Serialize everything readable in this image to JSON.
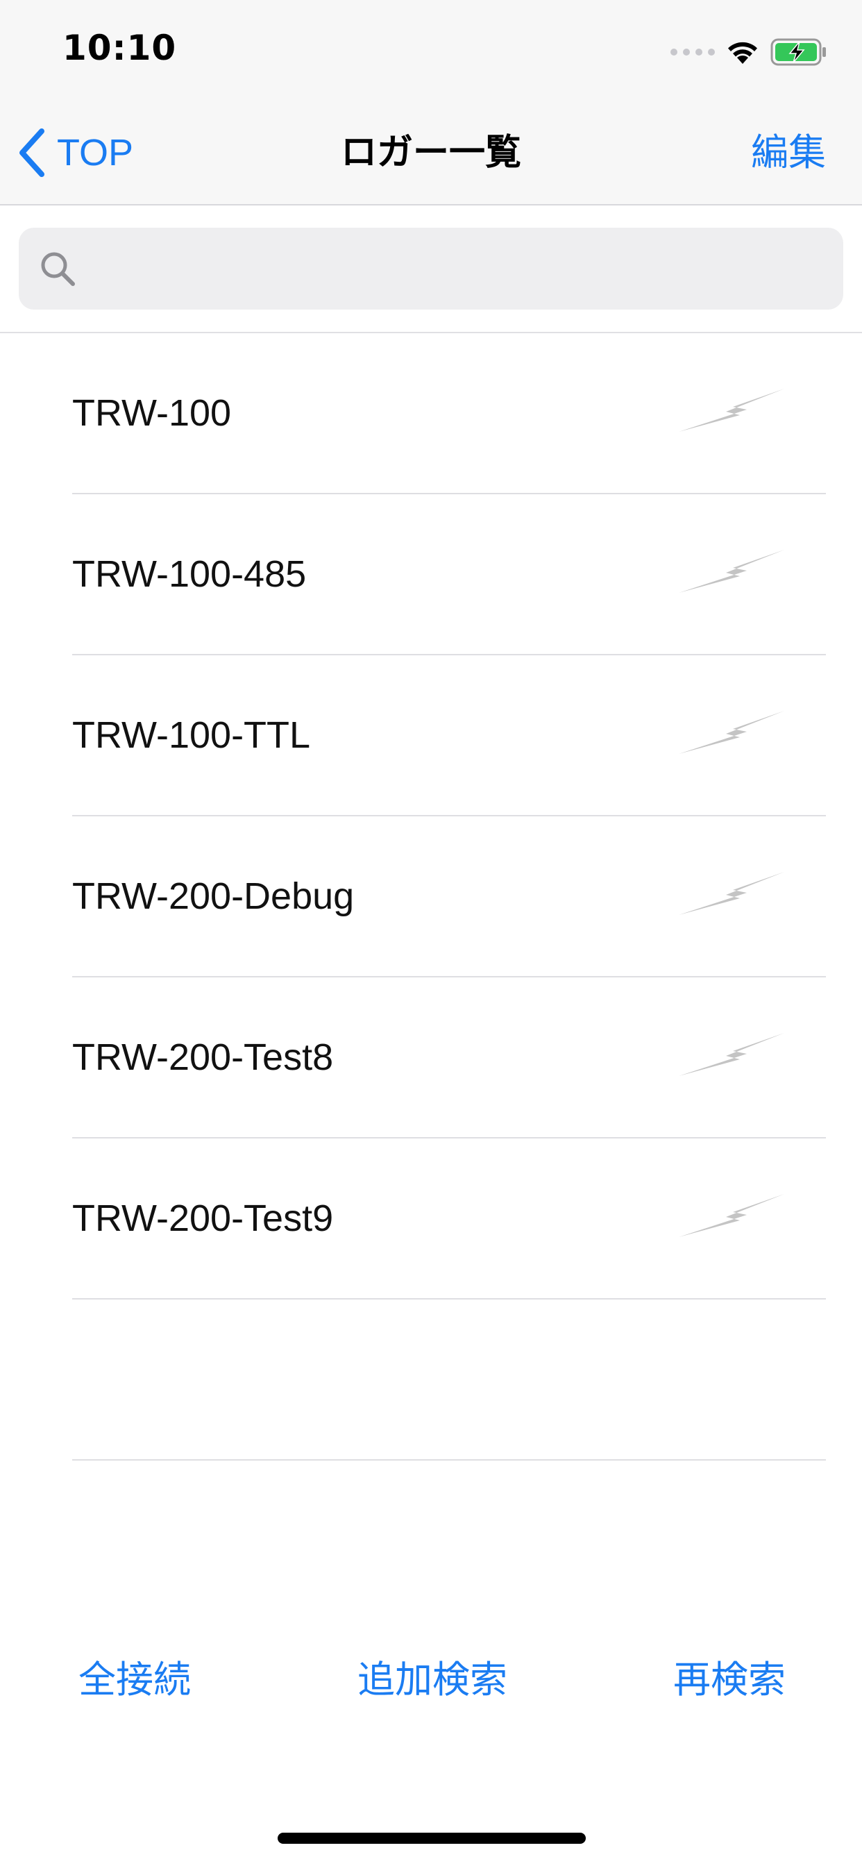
{
  "status_bar": {
    "time": "10:10"
  },
  "nav": {
    "back_label": "TOP",
    "title": "ロガー一覧",
    "edit_label": "編集"
  },
  "search": {
    "placeholder": "",
    "value": ""
  },
  "devices": [
    {
      "name": "TRW-100",
      "icon": "bolt-icon"
    },
    {
      "name": "TRW-100-485",
      "icon": "bolt-icon"
    },
    {
      "name": "TRW-100-TTL",
      "icon": "bolt-icon"
    },
    {
      "name": "TRW-200-Debug",
      "icon": "bolt-icon"
    },
    {
      "name": "TRW-200-Test8",
      "icon": "bolt-icon"
    },
    {
      "name": "TRW-200-Test9",
      "icon": "bolt-icon"
    }
  ],
  "toolbar": {
    "connect_all": "全接続",
    "add_search": "追加検索",
    "rescan": "再検索"
  },
  "colors": {
    "accent": "#1a7cf2",
    "battery": "#34c759",
    "bolt": "#c4c4c4"
  }
}
